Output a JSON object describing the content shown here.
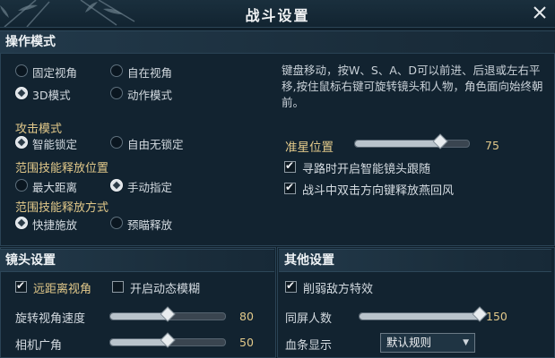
{
  "window": {
    "title": "战斗设置"
  },
  "operation": {
    "heading": "操作模式",
    "modes": [
      {
        "label": "固定视角",
        "selected": false
      },
      {
        "label": "自在视角",
        "selected": false
      },
      {
        "label": "3D模式",
        "selected": true
      },
      {
        "label": "动作模式",
        "selected": false
      }
    ],
    "description": "键盘移动，按W、S、A、D可以前进、后退或左右平移,按住鼠标右键可旋转镜头和人物，角色面向始终朝前。"
  },
  "attack": {
    "label": "攻击模式",
    "options": [
      {
        "label": "智能锁定",
        "selected": true
      },
      {
        "label": "自由无锁定",
        "selected": false
      }
    ]
  },
  "range_position": {
    "label": "范围技能释放位置",
    "options": [
      {
        "label": "最大距离",
        "selected": false
      },
      {
        "label": "手动指定",
        "selected": true
      }
    ]
  },
  "range_method": {
    "label": "范围技能释放方式",
    "options": [
      {
        "label": "快捷施放",
        "selected": true
      },
      {
        "label": "预瞄释放",
        "selected": false
      }
    ]
  },
  "crosshair": {
    "label": "准星位置",
    "value": "75",
    "fraction": 0.75
  },
  "right_checks": [
    {
      "label": "寻路时开启智能镜头跟随",
      "checked": true
    },
    {
      "label": "战斗中双击方向键释放燕回风",
      "checked": true
    }
  ],
  "camera": {
    "heading": "镜头设置",
    "checks": [
      {
        "label": "远距离视角",
        "checked": true
      },
      {
        "label": "开启动态模糊",
        "checked": false
      }
    ],
    "rotate": {
      "label": "旋转视角速度",
      "value": "80",
      "fraction": 0.5
    },
    "fov": {
      "label": "相机广角",
      "value": "50",
      "fraction": 0.5
    }
  },
  "other": {
    "heading": "其他设置",
    "check": {
      "label": "削弱敌方特效",
      "checked": true
    },
    "players": {
      "label": "同屏人数",
      "value": "150",
      "fraction": 1.0
    },
    "hpbar": {
      "label": "血条显示",
      "selected": "默认规则"
    }
  }
}
